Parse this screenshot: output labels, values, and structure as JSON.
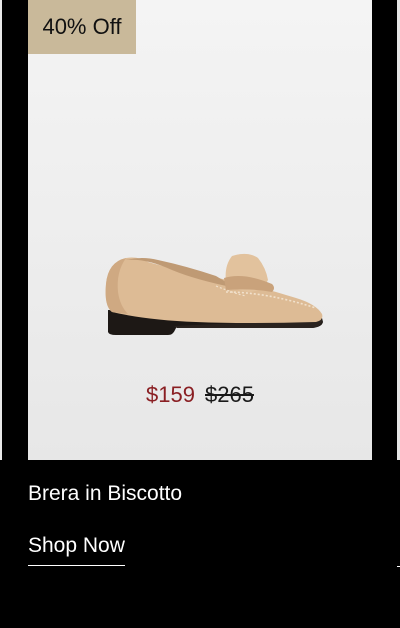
{
  "product": {
    "badge": "40% Off",
    "sale_price": "$159",
    "original_price": "$265",
    "name": "Brera in Biscotto",
    "cta": "Shop Now"
  },
  "colors": {
    "badge_bg": "#c9b99a",
    "sale_price": "#8a1f23",
    "page_bg": "#000000"
  },
  "icons": {
    "product_image": "penny-loafer-shoe"
  }
}
